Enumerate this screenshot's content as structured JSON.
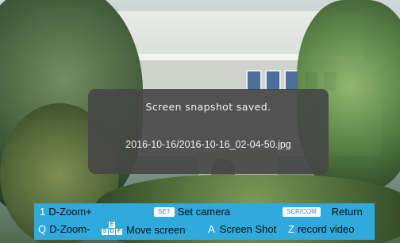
{
  "dialog": {
    "title": "Screen snapshot saved.",
    "path": "2016-10-16/2016-10-16_02-04-50.jpg"
  },
  "help_bar": {
    "row1": {
      "zoom_in_key": "1",
      "zoom_in_label": "D-Zoom+",
      "set_badge": "SET",
      "set_label": "Set camera",
      "return_badge": "SCR/COM",
      "return_label": "Return"
    },
    "row2": {
      "zoom_out_key": "Q",
      "zoom_out_label": "D-Zoom-",
      "move_keys": [
        "E",
        "S",
        "D",
        "F"
      ],
      "move_label": "Move screen",
      "shot_key": "A",
      "shot_label": "Screen Shot",
      "record_key": "Z",
      "record_label": "record video"
    }
  },
  "colors": {
    "help_bar_bg": "#30a9dc",
    "dialog_bg": "#464646",
    "key_color": "#ffffff"
  }
}
